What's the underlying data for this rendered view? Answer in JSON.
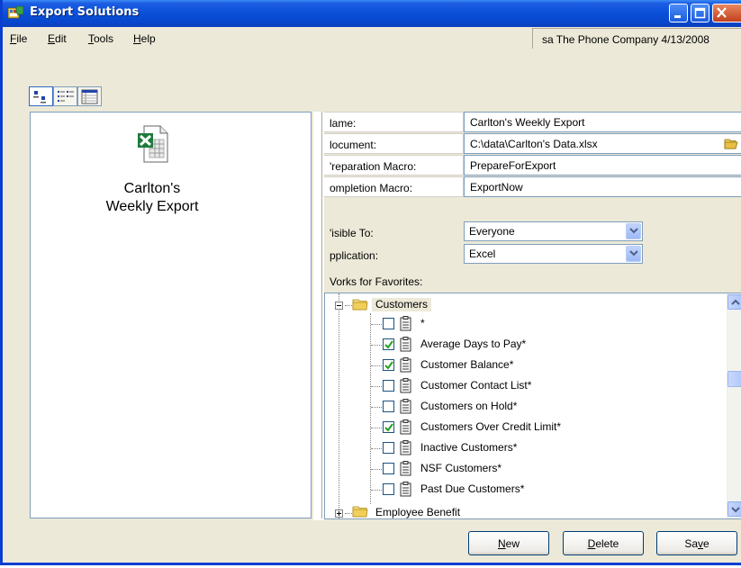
{
  "window": {
    "title": "Export Solutions"
  },
  "menu": {
    "items": [
      {
        "label": "File",
        "mnemonic": "F",
        "rest": "ile"
      },
      {
        "label": "Edit",
        "mnemonic": "E",
        "rest": "dit"
      },
      {
        "label": "Tools",
        "mnemonic": "T",
        "rest": "ools"
      },
      {
        "label": "Help",
        "mnemonic": "H",
        "rest": "elp"
      }
    ]
  },
  "status": {
    "text": "sa  The Phone Company  4/13/2008"
  },
  "view_toggle": {
    "icons": [
      "large-icons-view-icon",
      "list-view-icon",
      "details-view-icon"
    ],
    "selected": "large-icons-view-icon"
  },
  "document_list": {
    "items": [
      {
        "line1": "Carlton's",
        "line2": "Weekly Export",
        "icon": "excel-document-icon"
      }
    ]
  },
  "properties": {
    "name": {
      "label": "Name:",
      "shown_label": "lame:",
      "value": "Carlton's Weekly Export"
    },
    "document": {
      "label": "Document:",
      "shown_label": "locument:",
      "value": "C:\\data\\Carlton's Data.xlsx"
    },
    "preparation_macro": {
      "label": "Preparation Macro:",
      "shown_label": "'reparation Macro:",
      "value": "PrepareForExport"
    },
    "completion_macro": {
      "label": "Completion Macro:",
      "shown_label": "ompletion Macro:",
      "value": "ExportNow"
    }
  },
  "visible_to": {
    "label": "Visible To:",
    "shown_label": "'isible To:",
    "value": "Everyone"
  },
  "application": {
    "label": "Application:",
    "shown_label": "pplication:",
    "value": "Excel"
  },
  "favorites": {
    "label": "Works for Favorites:",
    "shown_label": "Vorks for Favorites:",
    "groups": [
      {
        "name": "Customers",
        "expanded": true,
        "items": [
          {
            "label": "*",
            "checked": false
          },
          {
            "label": "Average Days to Pay*",
            "checked": true
          },
          {
            "label": "Customer Balance*",
            "checked": true
          },
          {
            "label": "Customer Contact List*",
            "checked": false
          },
          {
            "label": "Customers on Hold*",
            "checked": false
          },
          {
            "label": "Customers Over Credit Limit*",
            "checked": true
          },
          {
            "label": "Inactive Customers*",
            "checked": false
          },
          {
            "label": "NSF Customers*",
            "checked": false
          },
          {
            "label": "Past Due Customers*",
            "checked": false
          }
        ]
      },
      {
        "name": "Employee Benefit",
        "expanded": false
      }
    ]
  },
  "buttons": {
    "new": {
      "label": "New",
      "mnemonic": "N",
      "rest": "ew"
    },
    "delete": {
      "label": "Delete",
      "mnemonic": "D",
      "rest": "elete"
    },
    "save": {
      "label": "Save",
      "pre": "Sa",
      "mnemonic": "v",
      "rest": "e"
    }
  },
  "colors": {
    "titlebar": "#0a4fd8",
    "window_bg": "#ece9d8",
    "field_border": "#7f9db9"
  }
}
